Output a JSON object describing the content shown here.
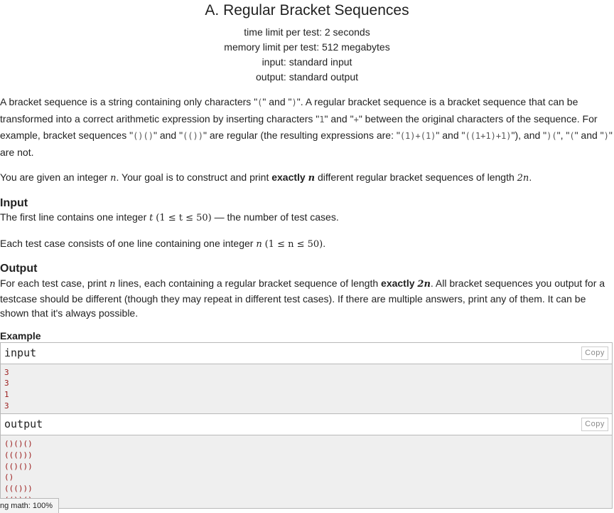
{
  "problem": {
    "title": "A. Regular Bracket Sequences",
    "time_limit": "time limit per test: 2 seconds",
    "memory_limit": "memory limit per test: 512 megabytes",
    "input_file": "input: standard input",
    "output_file": "output: standard output"
  },
  "statement": {
    "p1": {
      "a": "A bracket sequence is a string containing only characters \"",
      "c1": "(",
      "b": "\" and \"",
      "c2": ")",
      "c": "\". A regular bracket sequence is a bracket sequence that can be transformed into a correct arithmetic expression by inserting characters \"",
      "c3": "1",
      "d": "\" and \"",
      "c4": "+",
      "e": "\" between the original characters of the sequence. For example, bracket sequences \"",
      "c5": "()()",
      "f": "\" and \"",
      "c6": "(())",
      "g": "\" are regular (the resulting expressions are: \"",
      "c7": "(1)+(1)",
      "h": "\" and \"",
      "c8": "((1+1)+1)",
      "i": "\"), and \"",
      "c9": ")(",
      "j": "\", \"",
      "c10": "(",
      "k": "\" and \"",
      "c11": ")",
      "l": "\" are not."
    },
    "p2": {
      "a": "You are given an integer ",
      "n": "n",
      "b": ". Your goal is to construct and print ",
      "bold": "exactly",
      "n2": "n",
      "c": " different regular bracket sequences of length ",
      "expr": "2n",
      "d": "."
    }
  },
  "input_section": {
    "title": "Input",
    "l1a": "The first line contains one integer ",
    "t": "t",
    "l1math": "(1 ≤ t ≤ 50)",
    "l1b": " — the number of test cases.",
    "l2a": "Each test case consists of one line containing one integer ",
    "n": "n",
    "l2math": "(1 ≤ n ≤ 50)",
    "l2b": "."
  },
  "output_section": {
    "title": "Output",
    "a": "For each test case, print ",
    "n": "n",
    "b": " lines, each containing a regular bracket sequence of length ",
    "bold": "exactly",
    "expr": "2n",
    "c": ". All bracket sequences you output for a testcase should be different (though they may repeat in different test cases). If there are multiple answers, print any of them. It can be shown that it's always possible."
  },
  "example": {
    "title": "Example",
    "input_label": "input",
    "output_label": "output",
    "copy_label": "Copy",
    "input_lines": "3\n3\n1\n3",
    "output_lines": "()()()\n((()))\n(()())\n()\n((()))\n(())()"
  },
  "status_bar": {
    "text": "ng math: 100%"
  }
}
